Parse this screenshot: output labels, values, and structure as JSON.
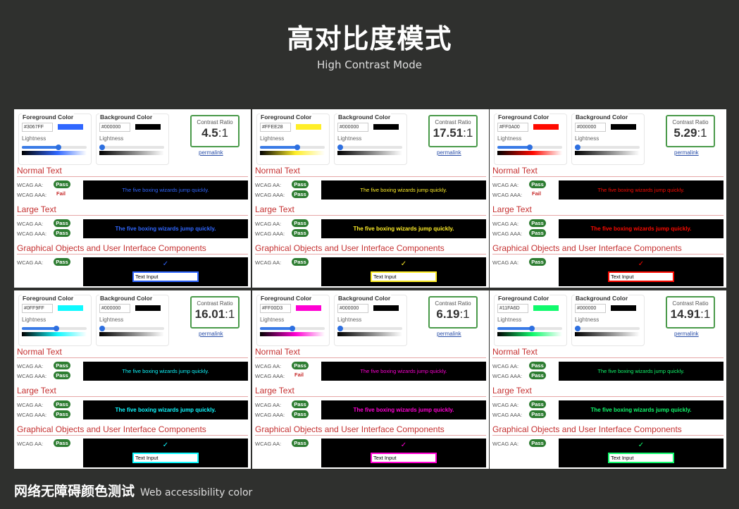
{
  "header": {
    "title": "高对比度模式",
    "subtitle": "High Contrast Mode"
  },
  "footer": {
    "title_cn": "网络无障碍颜色测试",
    "title_en": "Web accessibility color"
  },
  "labels": {
    "foreground": "Foreground Color",
    "background": "Background Color",
    "lightness": "Lightness",
    "contrast_ratio": "Contrast Ratio",
    "permalink": "permalink",
    "normal_text": "Normal Text",
    "large_text": "Large Text",
    "graphical": "Graphical Objects and User Interface Components",
    "wcag_aa": "WCAG AA:",
    "wcag_aaa": "WCAG AAA:",
    "sample": "The five boxing wizards jump quickly.",
    "text_input": "Text Input",
    "check": "✓"
  },
  "panels": [
    {
      "fg_hex": "#3067FF",
      "fg_color": "#3067ff",
      "bg_hex": "#000000",
      "bg_color": "#000000",
      "fg_lightness": 0.56,
      "bg_lightness": 0.0,
      "ratio_main": "4.5",
      "ratio_suffix": ":1",
      "normal_aa": "Pass",
      "normal_aaa": "Fail",
      "large_aa": "Pass",
      "large_aaa": "Pass",
      "graphic_aa": "Pass"
    },
    {
      "fg_hex": "#FFEE28",
      "fg_color": "#ffee28",
      "bg_hex": "#000000",
      "bg_color": "#000000",
      "fg_lightness": 0.58,
      "bg_lightness": 0.0,
      "ratio_main": "17.51",
      "ratio_suffix": ":1",
      "normal_aa": "Pass",
      "normal_aaa": "Pass",
      "large_aa": "Pass",
      "large_aaa": "Pass",
      "graphic_aa": "Pass"
    },
    {
      "fg_hex": "#FF0A00",
      "fg_color": "#ff0a00",
      "bg_hex": "#000000",
      "bg_color": "#000000",
      "fg_lightness": 0.5,
      "bg_lightness": 0.0,
      "ratio_main": "5.29",
      "ratio_suffix": ":1",
      "normal_aa": "Pass",
      "normal_aaa": "Fail",
      "large_aa": "Pass",
      "large_aaa": "Pass",
      "graphic_aa": "Pass"
    },
    {
      "fg_hex": "#0FF9FF",
      "fg_color": "#0ff9ff",
      "bg_hex": "#000000",
      "bg_color": "#000000",
      "fg_lightness": 0.53,
      "bg_lightness": 0.0,
      "ratio_main": "16.01",
      "ratio_suffix": ":1",
      "normal_aa": "Pass",
      "normal_aaa": "Pass",
      "large_aa": "Pass",
      "large_aaa": "Pass",
      "graphic_aa": "Pass"
    },
    {
      "fg_hex": "#FF00D3",
      "fg_color": "#ff00d3",
      "bg_hex": "#000000",
      "bg_color": "#000000",
      "fg_lightness": 0.5,
      "bg_lightness": 0.0,
      "ratio_main": "6.19",
      "ratio_suffix": ":1",
      "normal_aa": "Pass",
      "normal_aaa": "Fail",
      "large_aa": "Pass",
      "large_aaa": "Pass",
      "graphic_aa": "Pass"
    },
    {
      "fg_hex": "#11FA6D",
      "fg_color": "#11fa6d",
      "bg_hex": "#000000",
      "bg_color": "#000000",
      "fg_lightness": 0.53,
      "bg_lightness": 0.0,
      "ratio_main": "14.91",
      "ratio_suffix": ":1",
      "normal_aa": "Pass",
      "normal_aaa": "Pass",
      "large_aa": "Pass",
      "large_aaa": "Pass",
      "graphic_aa": "Pass"
    }
  ]
}
